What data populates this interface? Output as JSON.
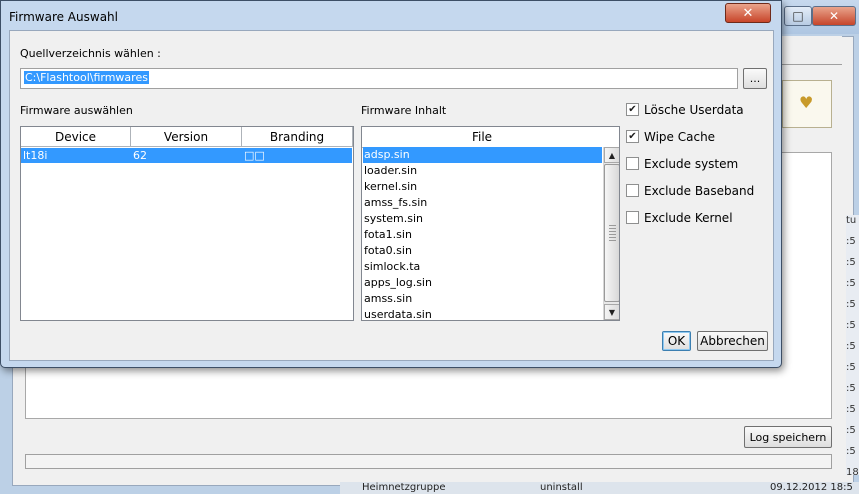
{
  "background_window": {
    "maximize_glyph": "□",
    "close_glyph": "✕",
    "card_icon": "♥",
    "log_save_label": "Log speichern",
    "side_fragments": [
      "tu",
      ":5",
      ":5",
      ":5",
      ":5",
      ":5",
      ":5",
      ":5",
      ":5",
      ":5",
      ":5",
      ":5",
      "18"
    ],
    "taskbar": {
      "item1": "Heimnetzgruppe",
      "item2": "uninstall",
      "timestamp": "09.12.2012 18:5"
    }
  },
  "dialog": {
    "title": "Firmware Auswahl",
    "close_glyph": "✕",
    "source_label": "Quellverzeichnis wählen :",
    "source_path": "C:\\Flashtool\\firmwares",
    "browse_label": "...",
    "firmware_select_label": "Firmware auswählen",
    "firmware_table": {
      "columns": [
        "Device",
        "Version",
        "Branding"
      ],
      "rows": [
        {
          "device": "lt18i",
          "version": "62",
          "branding": "□□"
        }
      ]
    },
    "firmware_content_label": "Firmware Inhalt",
    "file_list": {
      "header": "File",
      "items": [
        "adsp.sin",
        "loader.sin",
        "kernel.sin",
        "amss_fs.sin",
        "system.sin",
        "fota1.sin",
        "fota0.sin",
        "simlock.ta",
        "apps_log.sin",
        "amss.sin",
        "userdata.sin"
      ],
      "selected_index": 0
    },
    "options": [
      {
        "label": "Lösche Userdata",
        "checked": true
      },
      {
        "label": "Wipe Cache",
        "checked": true
      },
      {
        "label": "Exclude system",
        "checked": false
      },
      {
        "label": "Exclude Baseband",
        "checked": false
      },
      {
        "label": "Exclude Kernel",
        "checked": false
      }
    ],
    "check_glyph": "✔",
    "scroll_up_glyph": "▲",
    "scroll_down_glyph": "▼",
    "ok_label": "OK",
    "cancel_label": "Abbrechen"
  },
  "colors": {
    "selection": "#3399ff",
    "titlebar": "#c5d8ee",
    "close_button": "#c8452a"
  }
}
